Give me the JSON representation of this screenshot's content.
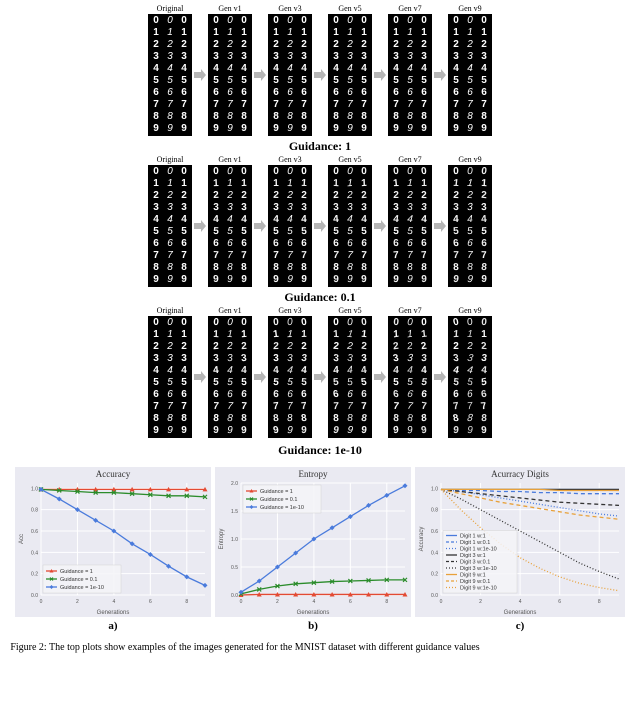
{
  "guidance_rows": [
    {
      "title": "",
      "variation_scale": 0.0
    },
    {
      "title": "Guidance: 1",
      "variation_scale": 0.35
    },
    {
      "title": "Guidance: 0.1",
      "variation_scale": 0.7
    },
    {
      "title": "Guidance: 1e-10",
      "variation_scale": null
    }
  ],
  "column_labels": [
    "Original",
    "Gen v1",
    "Gen v3",
    "Gen v5",
    "Gen v7",
    "Gen v9"
  ],
  "digit_rows": [
    0,
    1,
    2,
    3,
    4,
    5,
    6,
    7,
    8,
    9
  ],
  "chart_data": [
    {
      "type": "line",
      "title": "Accuracy",
      "xlabel": "Generations",
      "ylabel": "Acc",
      "xlim": [
        0,
        9
      ],
      "ylim": [
        0,
        1.05
      ],
      "x": [
        0,
        1,
        2,
        3,
        4,
        5,
        6,
        7,
        8,
        9
      ],
      "legend_pos": "lower-left",
      "series": [
        {
          "name": "Guidance = 1",
          "color": "#e34a33",
          "marker": "triangle",
          "values": [
            0.99,
            0.99,
            0.99,
            0.99,
            0.99,
            0.99,
            0.99,
            0.99,
            0.99,
            0.99
          ]
        },
        {
          "name": "Guidance = 0.1",
          "color": "#2b8c2b",
          "marker": "cross",
          "values": [
            0.99,
            0.98,
            0.97,
            0.96,
            0.96,
            0.95,
            0.94,
            0.93,
            0.93,
            0.92
          ]
        },
        {
          "name": "Guidance = 1e-10",
          "color": "#4a7bdc",
          "marker": "diamond",
          "values": [
            0.99,
            0.9,
            0.8,
            0.7,
            0.6,
            0.48,
            0.38,
            0.27,
            0.17,
            0.09
          ]
        }
      ]
    },
    {
      "type": "line",
      "title": "Entropy",
      "xlabel": "Generations",
      "ylabel": "Entropy",
      "xlim": [
        0,
        9
      ],
      "ylim": [
        0,
        2.0
      ],
      "x": [
        0,
        1,
        2,
        3,
        4,
        5,
        6,
        7,
        8,
        9
      ],
      "legend_pos": "upper-left",
      "series": [
        {
          "name": "Guidance = 1",
          "color": "#e34a33",
          "marker": "triangle",
          "values": [
            0.0,
            0.01,
            0.01,
            0.01,
            0.01,
            0.01,
            0.01,
            0.01,
            0.01,
            0.01
          ]
        },
        {
          "name": "Guidance = 0.1",
          "color": "#2b8c2b",
          "marker": "cross",
          "values": [
            0.02,
            0.1,
            0.16,
            0.2,
            0.22,
            0.24,
            0.25,
            0.26,
            0.27,
            0.27
          ]
        },
        {
          "name": "Guidance = 1e-10",
          "color": "#4a7bdc",
          "marker": "diamond",
          "values": [
            0.05,
            0.25,
            0.5,
            0.75,
            1.0,
            1.2,
            1.4,
            1.6,
            1.78,
            1.95
          ]
        }
      ]
    },
    {
      "type": "line",
      "title": "Acurracy Digits",
      "xlabel": "Generations",
      "ylabel": "Accuracy",
      "xlim": [
        0,
        9
      ],
      "ylim": [
        0,
        1.05
      ],
      "x": [
        0,
        1,
        2,
        3,
        4,
        5,
        6,
        7,
        8,
        9
      ],
      "legend_pos": "lower-left",
      "series": [
        {
          "name": "Digit 1 w:1",
          "color": "#4a7bdc",
          "style": "solid",
          "values": [
            0.99,
            0.99,
            0.99,
            0.99,
            0.99,
            0.99,
            0.99,
            0.99,
            0.99,
            0.99
          ]
        },
        {
          "name": "Digit 1 w:0.1",
          "color": "#4a7bdc",
          "style": "dash",
          "values": [
            0.99,
            0.98,
            0.98,
            0.97,
            0.97,
            0.96,
            0.96,
            0.95,
            0.95,
            0.95
          ]
        },
        {
          "name": "Digit 1 w:1e-10",
          "color": "#4a7bdc",
          "style": "dot",
          "values": [
            0.99,
            0.97,
            0.94,
            0.91,
            0.88,
            0.85,
            0.82,
            0.79,
            0.76,
            0.74
          ]
        },
        {
          "name": "Digit 3 w:1",
          "color": "#333333",
          "style": "solid",
          "values": [
            0.99,
            0.99,
            0.99,
            0.99,
            0.99,
            0.99,
            0.99,
            0.99,
            0.99,
            0.99
          ]
        },
        {
          "name": "Digit 3 w:0.1",
          "color": "#333333",
          "style": "dash",
          "values": [
            0.99,
            0.97,
            0.95,
            0.93,
            0.91,
            0.89,
            0.87,
            0.86,
            0.85,
            0.84
          ]
        },
        {
          "name": "Digit 3 w:1e-10",
          "color": "#333333",
          "style": "dot",
          "values": [
            0.99,
            0.9,
            0.8,
            0.7,
            0.6,
            0.5,
            0.4,
            0.3,
            0.22,
            0.15
          ]
        },
        {
          "name": "Digit 9 w:1",
          "color": "#e8a13a",
          "style": "solid",
          "values": [
            0.99,
            0.99,
            0.99,
            0.99,
            0.99,
            0.99,
            0.98,
            0.98,
            0.98,
            0.98
          ]
        },
        {
          "name": "Digit 9 w:0.1",
          "color": "#e8a13a",
          "style": "dash",
          "values": [
            0.99,
            0.95,
            0.91,
            0.87,
            0.84,
            0.81,
            0.78,
            0.75,
            0.73,
            0.71
          ]
        },
        {
          "name": "Digit 9 w:1e-10",
          "color": "#e8a13a",
          "style": "dot",
          "values": [
            0.99,
            0.8,
            0.63,
            0.48,
            0.35,
            0.25,
            0.17,
            0.11,
            0.07,
            0.04
          ]
        }
      ]
    }
  ],
  "plot_letters": [
    "a)",
    "b)",
    "c)"
  ],
  "caption": "Figure 2: The top plots show examples of the images generated for the MNIST dataset with different guidance values"
}
